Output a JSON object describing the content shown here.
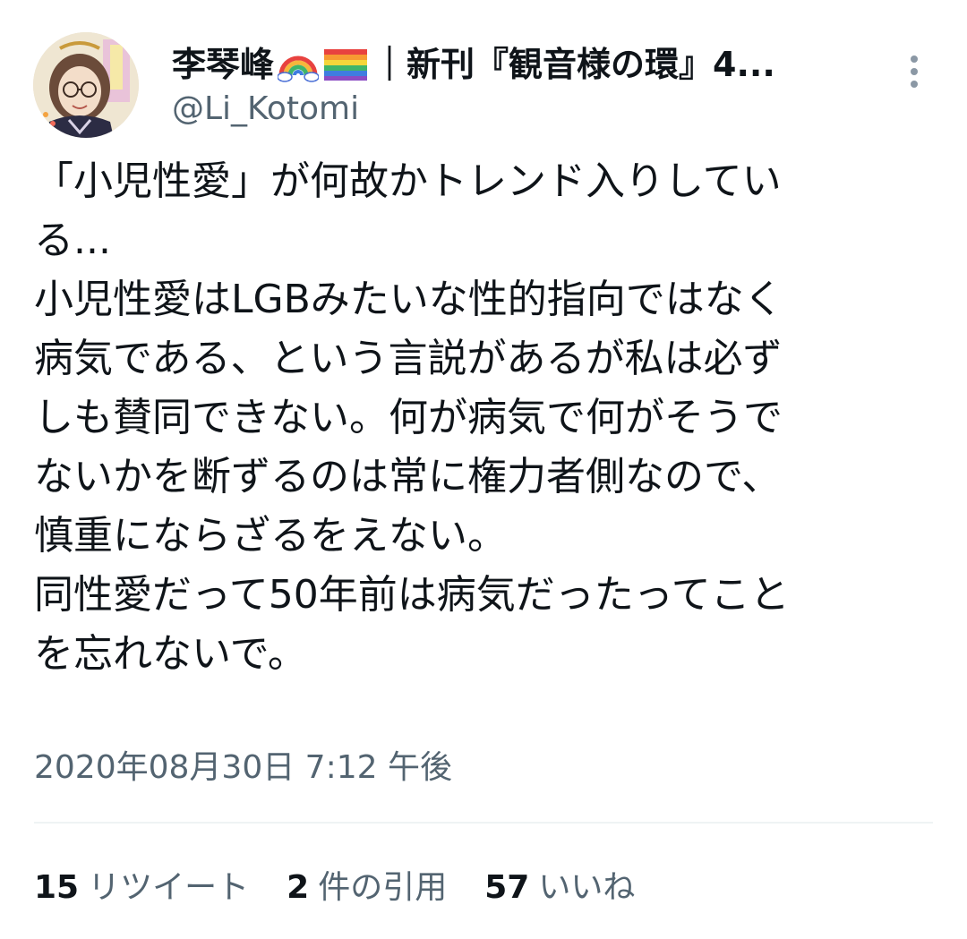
{
  "header": {
    "display_name": "李琴峰",
    "display_name_suffix": "｜新刊『観音様の環』4...",
    "handle": "@Li_Kotomi",
    "emoji_icons": [
      "rainbow-icon",
      "rainbow-flag-icon"
    ]
  },
  "tweet": {
    "lines": [
      "「小児性愛」が何故かトレンド入りしてい",
      "る...",
      "小児性愛はLGBみたいな性的指向ではなく",
      "病気である、という言説があるが私は必ず",
      "しも賛同できない。何が病気で何がそうで",
      "ないかを断ずるのは常に権力者側なので、",
      "慎重にならざるをえない。",
      "同性愛だって50年前は病気だったってこと",
      "を忘れないで。"
    ],
    "timestamp": "2020年08月30日 7:12 午後"
  },
  "stats": {
    "retweets_count": "15",
    "retweets_label": "リツイート",
    "quotes_count": "2",
    "quotes_label": "件の引用",
    "likes_count": "57",
    "likes_label": "いいね"
  },
  "colors": {
    "text_primary": "#0f1419",
    "text_secondary": "#536471",
    "divider": "#eff3f4"
  }
}
